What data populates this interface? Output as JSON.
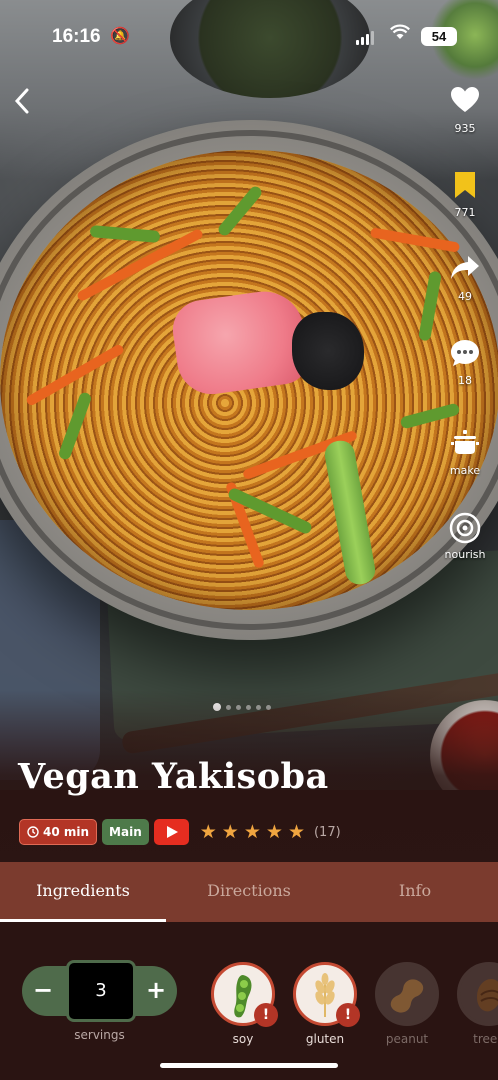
{
  "status_bar": {
    "time": "16:16",
    "battery": "54"
  },
  "rail": {
    "likes": "935",
    "saves": "771",
    "shares": "49",
    "comments": "18",
    "make": "make",
    "nourish": "nourish"
  },
  "carousel": {
    "total": 6,
    "active": 1
  },
  "recipe": {
    "title": "Vegan Yakisoba",
    "time": "40 min",
    "course": "Main",
    "rating_stars": 5,
    "rating_count": "(17)"
  },
  "tabs": [
    {
      "label": "Ingredients",
      "active": true
    },
    {
      "label": "Directions",
      "active": false
    },
    {
      "label": "Info",
      "active": false
    }
  ],
  "servings": {
    "value": "3",
    "label": "servings",
    "minus": "−",
    "plus": "+"
  },
  "allergens": [
    {
      "label": "soy",
      "icon": "soy-icon",
      "flagged": true
    },
    {
      "label": "gluten",
      "icon": "wheat-icon",
      "flagged": true
    },
    {
      "label": "peanut",
      "icon": "peanut-icon",
      "flagged": false
    },
    {
      "label": "treen",
      "icon": "tree-nut-icon",
      "flagged": false
    }
  ],
  "colors": {
    "accent": "#b33526",
    "tab_bar": "#7b3b2e",
    "background": "#2a1412",
    "green": "#4f6b4b",
    "star": "#f0a540"
  }
}
